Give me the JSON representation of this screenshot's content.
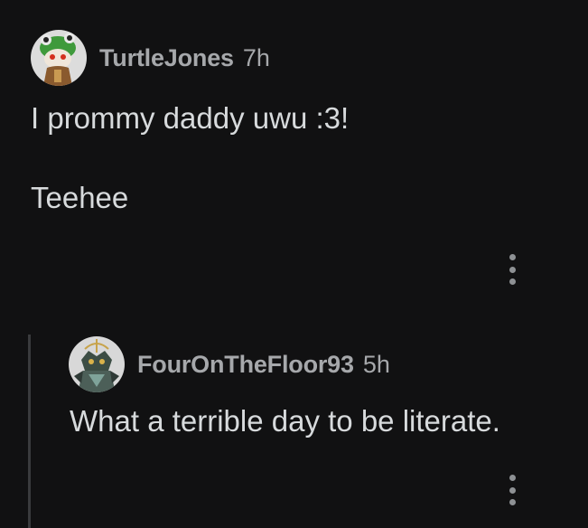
{
  "comment": {
    "author": "TurtleJones",
    "age": "7h",
    "body_line1": "I prommy daddy uwu :3!",
    "body_line2": "Teehee",
    "avatar_icon": "frog-hat-avatar-icon",
    "more_icon": "more-options-icon"
  },
  "reply": {
    "author": "FourOnTheFloor93",
    "age": "5h",
    "body": "What a terrible day to be literate.",
    "avatar_icon": "armored-creature-avatar-icon",
    "more_icon": "more-options-icon"
  },
  "colors": {
    "background": "#111112",
    "username": "#a6a8ab",
    "body_text": "#d7dadc",
    "thread_line": "#3a3b3d"
  }
}
